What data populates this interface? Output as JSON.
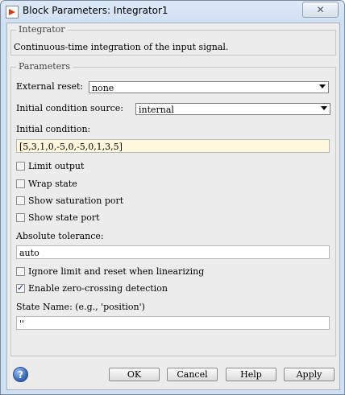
{
  "window": {
    "title": "Block Parameters: Integrator1",
    "close_symbol": "✕"
  },
  "integrator_group": {
    "title": "Integrator",
    "description": "Continuous-time integration of the input signal."
  },
  "parameters": {
    "title": "Parameters",
    "external_reset": {
      "label": "External reset:",
      "value": "none"
    },
    "initial_condition_source": {
      "label": "Initial condition source:",
      "value": "internal"
    },
    "initial_condition": {
      "label": "Initial condition:",
      "value": "[5,3,1,0,-5,0,-5,0,1,3,5]"
    },
    "limit_output": {
      "label": "Limit output",
      "checked": false
    },
    "wrap_state": {
      "label": "Wrap state",
      "checked": false
    },
    "show_saturation_port": {
      "label": "Show saturation port",
      "checked": false
    },
    "show_state_port": {
      "label": "Show state port",
      "checked": false
    },
    "absolute_tolerance": {
      "label": "Absolute tolerance:",
      "value": "auto"
    },
    "ignore_limit_reset": {
      "label": "Ignore limit and reset when linearizing",
      "checked": false
    },
    "enable_zero_crossing": {
      "label": "Enable zero-crossing detection",
      "checked": true
    },
    "state_name": {
      "label": "State Name: (e.g., 'position')",
      "value": "''"
    }
  },
  "buttons": {
    "help_icon": "?",
    "ok": "OK",
    "cancel": "Cancel",
    "help": "Help",
    "apply": "Apply"
  }
}
